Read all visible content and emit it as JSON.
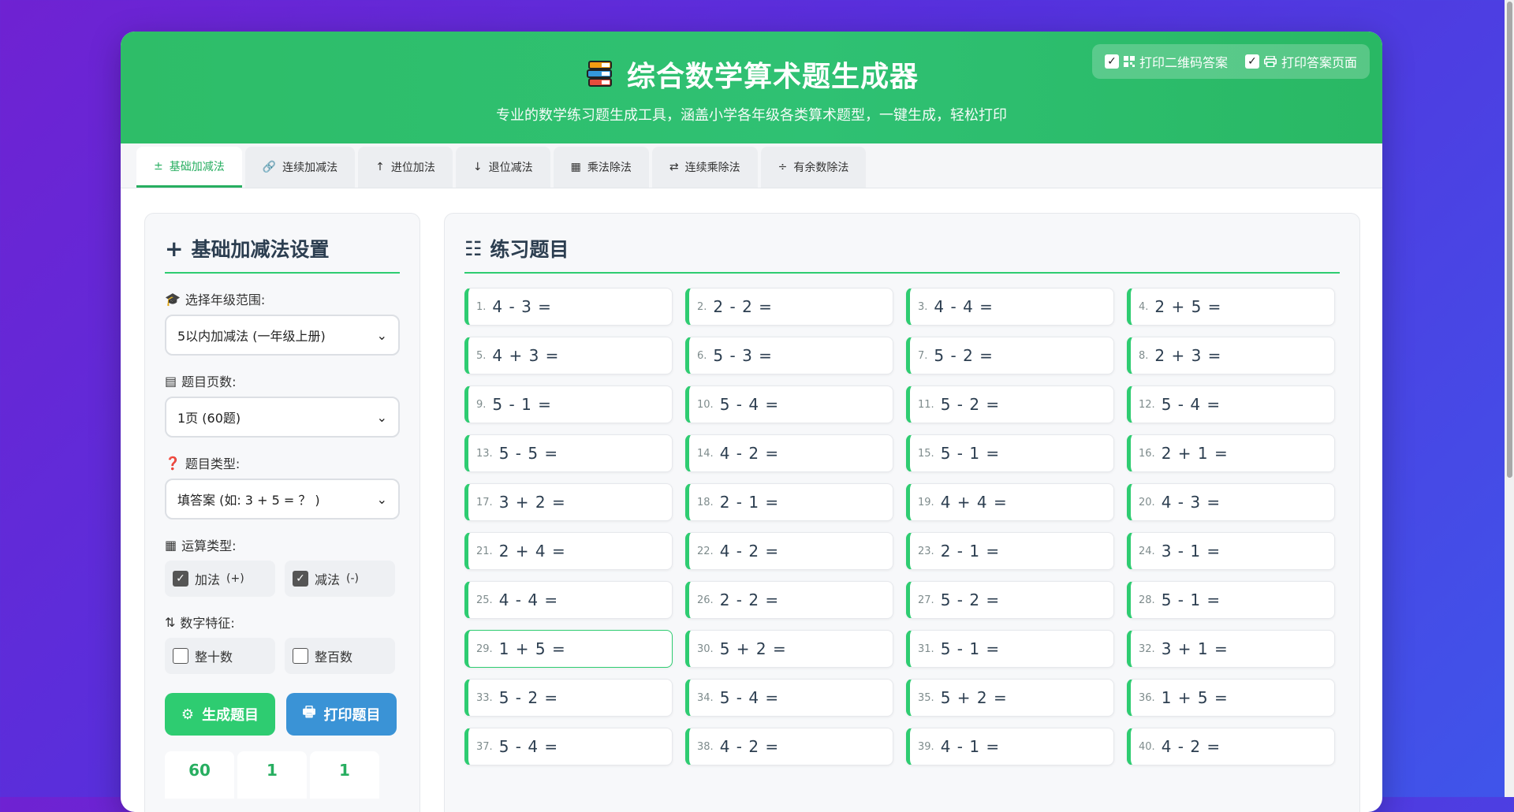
{
  "header": {
    "title": "综合数学算术题生成器",
    "subtitle": "专业的数学练习题生成工具，涵盖小学各年级各类算术题型，一键生成，轻松打印",
    "print_options": [
      {
        "label": "打印二维码答案",
        "checked": true,
        "icon": "qrcode-icon"
      },
      {
        "label": "打印答案页面",
        "checked": true,
        "icon": "printer-icon"
      }
    ]
  },
  "tabs": [
    {
      "label": "基础加减法",
      "icon": "plus-minus-icon",
      "active": true
    },
    {
      "label": "连续加减法",
      "icon": "link-icon"
    },
    {
      "label": "进位加法",
      "icon": "arrow-up-icon"
    },
    {
      "label": "退位减法",
      "icon": "arrow-down-icon"
    },
    {
      "label": "乘法除法",
      "icon": "calculator-icon"
    },
    {
      "label": "连续乘除法",
      "icon": "exchange-icon"
    },
    {
      "label": "有余数除法",
      "icon": "divide-icon"
    }
  ],
  "sidebar": {
    "title": "基础加减法设置",
    "grade_label": "选择年级范围:",
    "grade_value": "5以内加减法 (一年级上册)",
    "pages_label": "题目页数:",
    "pages_value": "1页 (60题)",
    "type_label": "题目类型:",
    "type_value": "填答案 (如: 3 + 5 = ？ )",
    "ops_label": "运算类型:",
    "ops": [
      {
        "label": "加法",
        "sym": "(+)",
        "checked": true
      },
      {
        "label": "减法",
        "sym": "(-)",
        "checked": true
      }
    ],
    "feature_label": "数字特征:",
    "features": [
      {
        "label": "整十数",
        "checked": false
      },
      {
        "label": "整百数",
        "checked": false
      }
    ],
    "generate_label": "生成题目",
    "print_label": "打印题目",
    "stats": [
      "60",
      "1",
      "1"
    ]
  },
  "main": {
    "title": "练习题目",
    "questions": [
      "4 - 3 =",
      "2 - 2 =",
      "4 - 4 =",
      "2 + 5 =",
      "4 + 3 =",
      "5 - 3 =",
      "5 - 2 =",
      "2 + 3 =",
      "5 - 1 =",
      "5 - 4 =",
      "5 - 2 =",
      "5 - 4 =",
      "5 - 5 =",
      "4 - 2 =",
      "5 - 1 =",
      "2 + 1 =",
      "3 + 2 =",
      "2 - 1 =",
      "4 + 4 =",
      "4 - 3 =",
      "2 + 4 =",
      "4 - 2 =",
      "2 - 1 =",
      "3 - 1 =",
      "4 - 4 =",
      "2 - 2 =",
      "5 - 2 =",
      "5 - 1 =",
      "1 + 5 =",
      "5 + 2 =",
      "5 - 1 =",
      "3 + 1 =",
      "5 - 2 =",
      "5 - 4 =",
      "5 + 2 =",
      "1 + 5 =",
      "5 - 4 =",
      "4 - 2 =",
      "4 - 1 =",
      "4 - 2 ="
    ],
    "highlighted_index": 28
  }
}
